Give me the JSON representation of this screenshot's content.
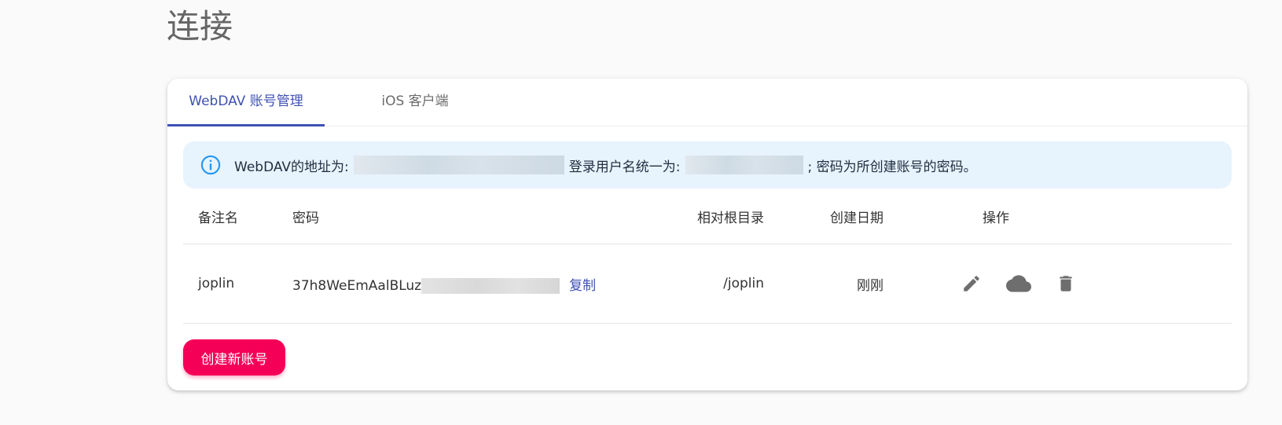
{
  "page": {
    "title": "连接"
  },
  "tabs": [
    {
      "label": "WebDAV 账号管理",
      "active": true
    },
    {
      "label": "iOS 客户端",
      "active": false
    }
  ],
  "alert": {
    "prefix": "WebDAV的地址为:",
    "middle": "登录用户名统一为:",
    "suffix": "; 密码为所创建账号的密码。"
  },
  "table": {
    "headers": {
      "name": "备注名",
      "password": "密码",
      "root": "相对根目录",
      "date": "创建日期",
      "ops": "操作"
    },
    "rows": [
      {
        "name": "joplin",
        "password_visible": "37h8WeEmAalBLuz",
        "copy": "复制",
        "root": "/joplin",
        "date": "刚刚"
      }
    ]
  },
  "actions": {
    "create": "创建新账号"
  },
  "colors": {
    "primary": "#3f51b5",
    "accent": "#f50057",
    "info_bg": "#e7f3fd",
    "icon": "#6e6e6e"
  }
}
